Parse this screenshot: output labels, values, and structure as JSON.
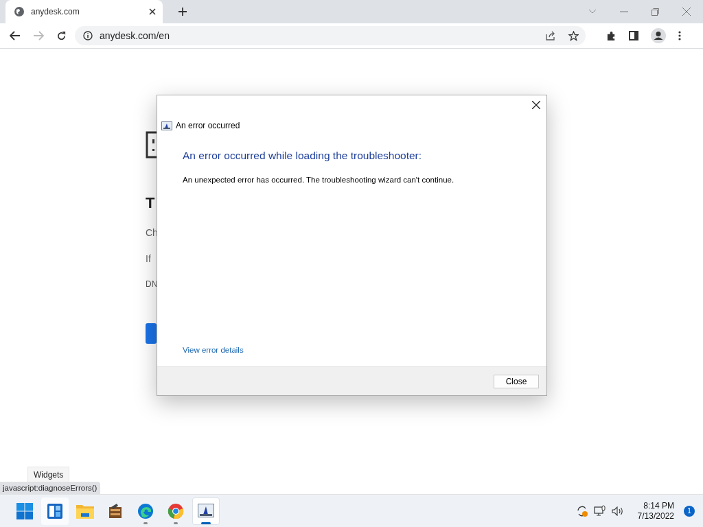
{
  "browser": {
    "tab": {
      "title": "anydesk.com"
    },
    "address": "anydesk.com/en"
  },
  "page": {
    "heading": "T",
    "lines": [
      "Ch",
      "If",
      "DN"
    ]
  },
  "dialog": {
    "title": "An error occurred",
    "heading": "An error occurred while loading the troubleshooter:",
    "message": "An unexpected error has occurred. The troubleshooting wizard can't continue.",
    "link": "View error details",
    "button": "Close"
  },
  "status_url": "javascript:diagnoseErrors()",
  "tooltip": "Widgets",
  "taskbar": {
    "apps": [
      {
        "kind": "start",
        "running": false,
        "active": false,
        "hovered": false
      },
      {
        "kind": "widgets",
        "running": false,
        "active": false,
        "hovered": true
      },
      {
        "kind": "folder",
        "running": false,
        "active": false,
        "hovered": false
      },
      {
        "kind": "archive",
        "running": false,
        "active": false,
        "hovered": false
      },
      {
        "kind": "edge",
        "running": true,
        "active": false,
        "hovered": false
      },
      {
        "kind": "chrome",
        "running": true,
        "active": false,
        "hovered": false
      },
      {
        "kind": "troubleshooter",
        "running": true,
        "active": true,
        "hovered": false
      }
    ],
    "time": "8:14 PM",
    "date": "7/13/2022",
    "notifications": "1"
  }
}
